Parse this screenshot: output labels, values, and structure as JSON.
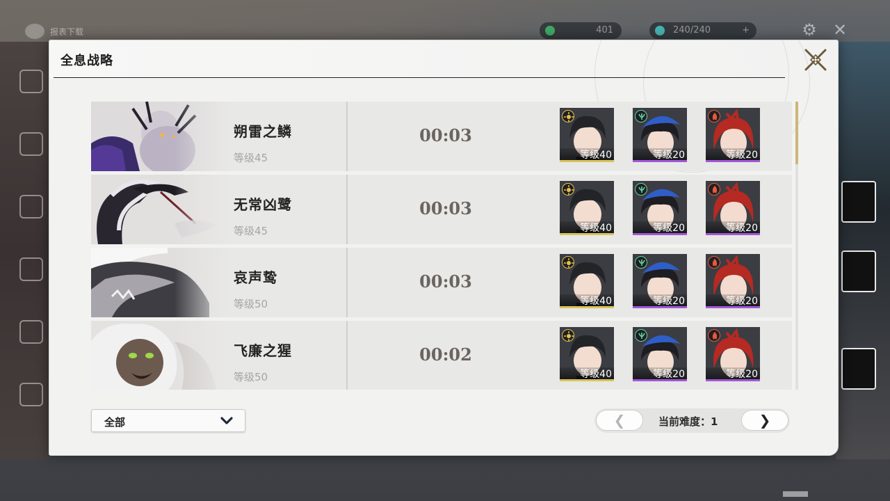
{
  "background": {
    "top_left_label": "报表下载",
    "currency_value": "401",
    "stamina_value": "240/240"
  },
  "dialog": {
    "title": "全息战略"
  },
  "bosses": [
    {
      "name": "朔雷之鳞",
      "level": "等级45",
      "time": "00:03",
      "team": [
        {
          "level": "等级40",
          "element": "spectro",
          "element_color": "#e6c14a",
          "rarity_color": "#d9c45a",
          "hair": "#222428"
        },
        {
          "level": "等级20",
          "element": "aero",
          "element_color": "#5fd3a0",
          "rarity_color": "#a257d6",
          "hair": "#1d1d22",
          "hat": "#2f5ec9"
        },
        {
          "level": "等级20",
          "element": "fusion",
          "element_color": "#e8583b",
          "rarity_color": "#a257d6",
          "hair": "#b52a22"
        }
      ]
    },
    {
      "name": "无常凶鹭",
      "level": "等级45",
      "time": "00:03",
      "team": [
        {
          "level": "等级40",
          "element": "spectro",
          "element_color": "#e6c14a",
          "rarity_color": "#d9c45a",
          "hair": "#222428"
        },
        {
          "level": "等级20",
          "element": "aero",
          "element_color": "#5fd3a0",
          "rarity_color": "#a257d6",
          "hair": "#1d1d22",
          "hat": "#2f5ec9"
        },
        {
          "level": "等级20",
          "element": "fusion",
          "element_color": "#e8583b",
          "rarity_color": "#a257d6",
          "hair": "#b52a22"
        }
      ]
    },
    {
      "name": "哀声鸷",
      "level": "等级50",
      "time": "00:03",
      "team": [
        {
          "level": "等级40",
          "element": "spectro",
          "element_color": "#e6c14a",
          "rarity_color": "#d9c45a",
          "hair": "#222428"
        },
        {
          "level": "等级20",
          "element": "aero",
          "element_color": "#5fd3a0",
          "rarity_color": "#a257d6",
          "hair": "#1d1d22",
          "hat": "#2f5ec9"
        },
        {
          "level": "等级20",
          "element": "fusion",
          "element_color": "#e8583b",
          "rarity_color": "#a257d6",
          "hair": "#b52a22"
        }
      ]
    },
    {
      "name": "飞廉之猩",
      "level": "等级50",
      "time": "00:02",
      "team": [
        {
          "level": "等级40",
          "element": "spectro",
          "element_color": "#e6c14a",
          "rarity_color": "#d9c45a",
          "hair": "#222428"
        },
        {
          "level": "等级20",
          "element": "aero",
          "element_color": "#5fd3a0",
          "rarity_color": "#a257d6",
          "hair": "#1d1d22",
          "hat": "#2f5ec9"
        },
        {
          "level": "等级20",
          "element": "fusion",
          "element_color": "#e8583b",
          "rarity_color": "#a257d6",
          "hair": "#b52a22"
        }
      ]
    }
  ],
  "footer": {
    "filter_label": "全部",
    "difficulty_label": "当前难度：",
    "difficulty_value": "1",
    "prev_glyph": "❮",
    "next_glyph": "❯"
  },
  "colors": {
    "accent_gold": "#cdb777",
    "panel_bg": "#f2f2f1",
    "row_bg": "#e8e8e6"
  }
}
